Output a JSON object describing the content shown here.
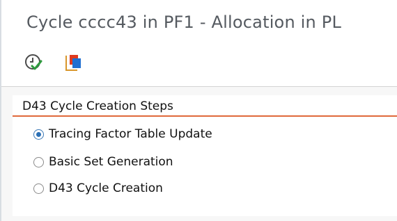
{
  "window": {
    "title": "Cycle cccc43 in PF1 - Allocation in PL"
  },
  "toolbar": {
    "buttons": [
      {
        "name": "execute",
        "icon": "execute-clock-check-icon"
      },
      {
        "name": "copy",
        "icon": "copy-documents-icon"
      }
    ]
  },
  "steps_group": {
    "title": "D43 Cycle Creation Steps",
    "options": [
      {
        "label": "Tracing Factor Table Update",
        "selected": true
      },
      {
        "label": "Basic Set Generation",
        "selected": false
      },
      {
        "label": "D43 Cycle Creation",
        "selected": false
      }
    ]
  },
  "colors": {
    "accent_underline": "#e0683a",
    "radio_selected": "#2a6fb5",
    "title_text": "#555a60"
  }
}
